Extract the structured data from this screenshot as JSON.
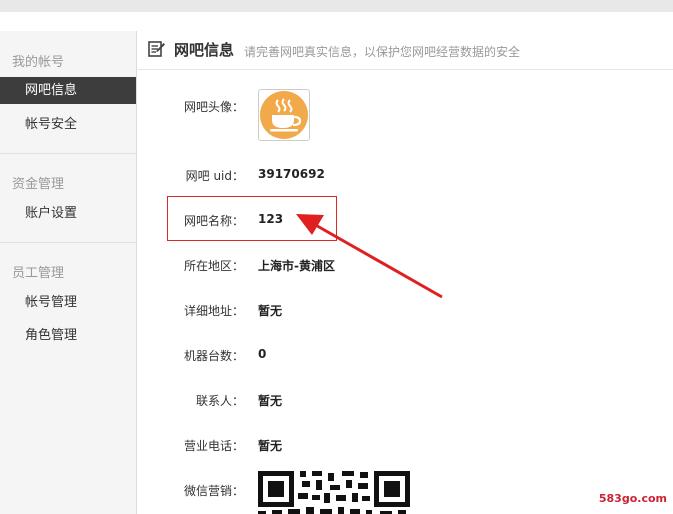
{
  "sidebar": {
    "groups": [
      {
        "title": "我的帐号",
        "items": [
          {
            "label": "网吧信息",
            "active": true
          },
          {
            "label": "帐号安全"
          }
        ]
      },
      {
        "title": "资金管理",
        "items": [
          {
            "label": "账户设置"
          }
        ]
      },
      {
        "title": "员工管理",
        "items": [
          {
            "label": "帐号管理"
          },
          {
            "label": "角色管理"
          }
        ]
      }
    ]
  },
  "header": {
    "title": "网吧信息",
    "subtitle": "请完善网吧真实信息，以保护您网吧经营数据的安全"
  },
  "fields": [
    {
      "label": "网吧头像：",
      "value": ""
    },
    {
      "label": "网吧 uid：",
      "value": "39170692"
    },
    {
      "label": "网吧名称：",
      "value": "123"
    },
    {
      "label": "所在地区：",
      "value": "上海市-黄浦区"
    },
    {
      "label": "详细地址：",
      "value": "暂无"
    },
    {
      "label": "机器台数：",
      "value": "0"
    },
    {
      "label": "联系人：",
      "value": "暂无"
    },
    {
      "label": "营业电话：",
      "value": "暂无"
    },
    {
      "label": "微信营销：",
      "value": ""
    }
  ],
  "watermark": "583go.com",
  "colors": {
    "accent": "#3d3d3d",
    "highlight": "#d62a2a",
    "avatar": "#f2a94a"
  },
  "icons": {
    "header": "edit-form-icon",
    "avatar": "coffee-cup-icon"
  }
}
